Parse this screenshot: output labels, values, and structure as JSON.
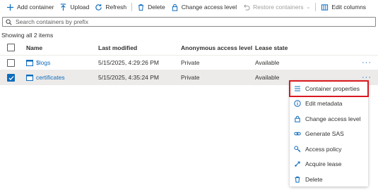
{
  "toolbar": {
    "add_container": "Add container",
    "upload": "Upload",
    "refresh": "Refresh",
    "delete": "Delete",
    "change_access_level": "Change access level",
    "restore_containers": "Restore containers",
    "edit_columns": "Edit columns"
  },
  "search": {
    "placeholder": "Search containers by prefix"
  },
  "item_count": "Showing all 2 items",
  "columns": [
    "Name",
    "Last modified",
    "Anonymous access level",
    "Lease state"
  ],
  "rows": [
    {
      "name": "$logs",
      "last_modified": "5/15/2025, 4:29:26 PM",
      "access": "Private",
      "lease": "Available",
      "selected": false
    },
    {
      "name": "certificates",
      "last_modified": "5/15/2025, 4:35:24 PM",
      "access": "Private",
      "lease": "Available",
      "selected": true
    }
  ],
  "context_menu": {
    "items": [
      {
        "label": "Container properties",
        "icon": "properties-icon"
      },
      {
        "label": "Edit metadata",
        "icon": "info-icon"
      },
      {
        "label": "Change access level",
        "icon": "lock-icon"
      },
      {
        "label": "Generate SAS",
        "icon": "link-icon"
      },
      {
        "label": "Access policy",
        "icon": "key-icon"
      },
      {
        "label": "Acquire lease",
        "icon": "lease-icon"
      },
      {
        "label": "Delete",
        "icon": "delete-icon"
      }
    ],
    "highlighted_index": 0
  },
  "colors": {
    "accent": "#0f6cbd",
    "highlight_border": "#d9181f",
    "selected_row": "#edebe9"
  }
}
